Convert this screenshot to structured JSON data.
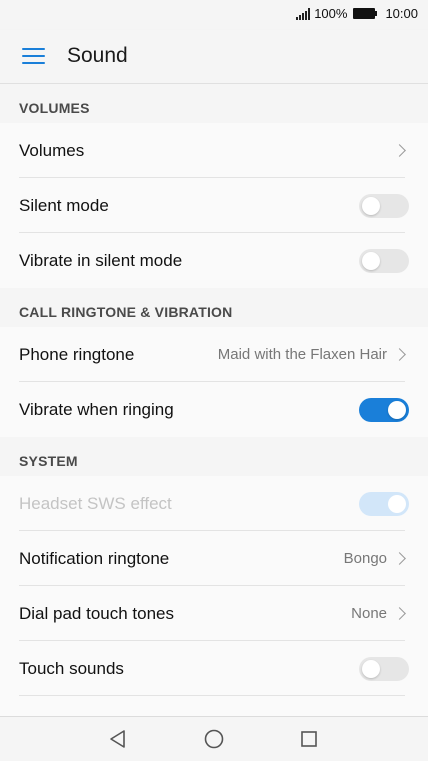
{
  "status_bar": {
    "battery_percent": "100%",
    "time": "10:00"
  },
  "app_bar": {
    "title": "Sound",
    "menu_icon": "hamburger-menu-icon"
  },
  "sections": [
    {
      "header": "VOLUMES",
      "items": [
        {
          "label": "Volumes",
          "type": "link"
        },
        {
          "label": "Silent mode",
          "type": "toggle",
          "on": false
        },
        {
          "label": "Vibrate in silent mode",
          "type": "toggle",
          "on": false
        }
      ]
    },
    {
      "header": "CALL RINGTONE & VIBRATION",
      "items": [
        {
          "label": "Phone ringtone",
          "type": "link",
          "value": "Maid with the Flaxen Hair"
        },
        {
          "label": "Vibrate when ringing",
          "type": "toggle",
          "on": true
        }
      ]
    },
    {
      "header": "SYSTEM",
      "items": [
        {
          "label": "Headset SWS effect",
          "type": "toggle",
          "on": true,
          "disabled": true
        },
        {
          "label": "Notification ringtone",
          "type": "link",
          "value": "Bongo"
        },
        {
          "label": "Dial pad touch tones",
          "type": "link",
          "value": "None"
        },
        {
          "label": "Touch sounds",
          "type": "toggle",
          "on": false
        }
      ]
    }
  ],
  "nav_bar": {
    "icons": [
      "back-icon",
      "home-icon",
      "recents-icon"
    ]
  },
  "colors": {
    "accent": "#1a7fd9",
    "background": "#f5f5f5",
    "row_background": "#fafafa",
    "toggle_off": "#e6e6e6",
    "toggle_disabled_on": "#d2e6f9"
  }
}
